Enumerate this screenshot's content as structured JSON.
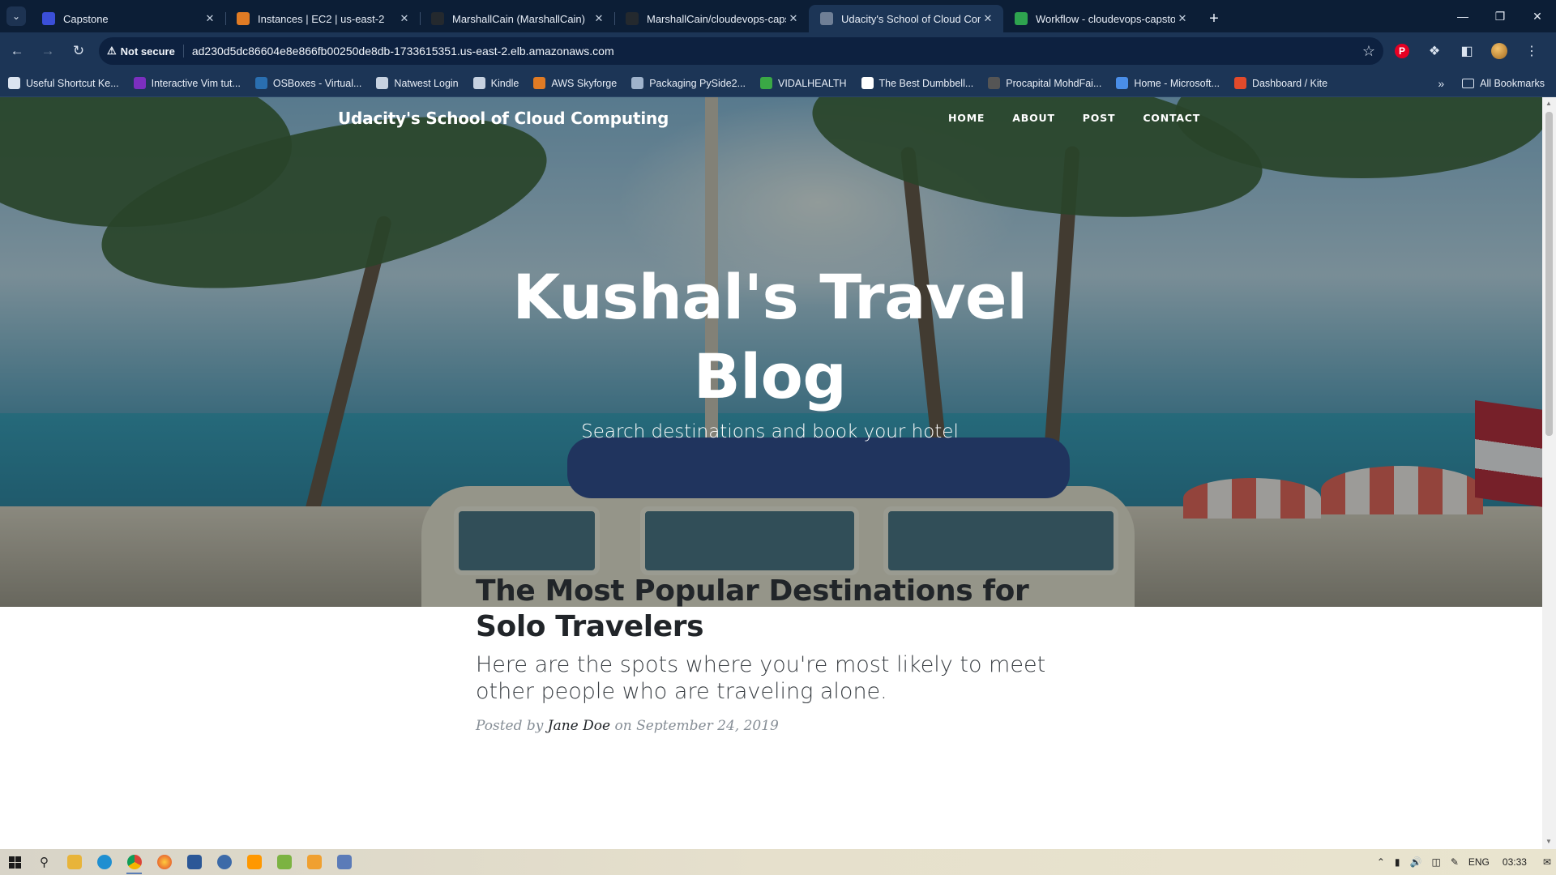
{
  "browser": {
    "tabs": [
      {
        "title": "Capstone",
        "favicon_color": "#3b4fd8",
        "active": false
      },
      {
        "title": "Instances | EC2 | us-east-2",
        "favicon_color": "#e07b24",
        "active": false
      },
      {
        "title": "MarshallCain (MarshallCain)",
        "favicon_color": "#24292e",
        "active": false
      },
      {
        "title": "MarshallCain/cloudevops-caps",
        "favicon_color": "#24292e",
        "active": false
      },
      {
        "title": "Udacity's School of Cloud Com",
        "favicon_color": "#6f7f96",
        "active": true
      },
      {
        "title": "Workflow - cloudevops-capsto",
        "favicon_color": "#2ea44f",
        "active": false
      }
    ],
    "new_tab_label": "+",
    "security_label": "Not secure",
    "url": "ad230d5dc86604e8e866fb00250de8db-1733615351.us-east-2.elb.amazonaws.com",
    "bookmarks": [
      {
        "label": "Useful Shortcut Ke...",
        "color": "#dbe4f0"
      },
      {
        "label": "Interactive Vim tut...",
        "color": "#7b2fbf"
      },
      {
        "label": "OSBoxes - Virtual...",
        "color": "#2a6fb0"
      },
      {
        "label": "Natwest Login",
        "color": "#c7d2e1"
      },
      {
        "label": "Kindle",
        "color": "#c7d2e1"
      },
      {
        "label": "AWS Skyforge",
        "color": "#e07b24"
      },
      {
        "label": "Packaging PySide2...",
        "color": "#9fb3cc"
      },
      {
        "label": "VIDALHEALTH",
        "color": "#3aa845"
      },
      {
        "label": "The Best Dumbbell...",
        "color": "#ffffff"
      },
      {
        "label": "Procapital MohdFai...",
        "color": "#555555"
      },
      {
        "label": "Home - Microsoft...",
        "color": "#4a8ee8"
      },
      {
        "label": "Dashboard / Kite",
        "color": "#e24a2b"
      }
    ],
    "all_bookmarks_label": "All Bookmarks"
  },
  "site": {
    "brand": "Udacity's School of Cloud Computing",
    "nav": [
      "HOME",
      "ABOUT",
      "POST",
      "CONTACT"
    ],
    "hero_title": "Kushal's Travel Blog",
    "hero_subtitle": "Search destinations and book your hotel"
  },
  "post": {
    "title": "The Most Popular Destinations for Solo Travelers",
    "subtitle": "Here are the spots where you're most likely to meet other people who are traveling alone.",
    "meta_prefix": "Posted by",
    "author": "Jane Doe",
    "meta_on": "on",
    "date": "September 24, 2019"
  },
  "taskbar": {
    "language": "ENG",
    "time": "03:33"
  }
}
